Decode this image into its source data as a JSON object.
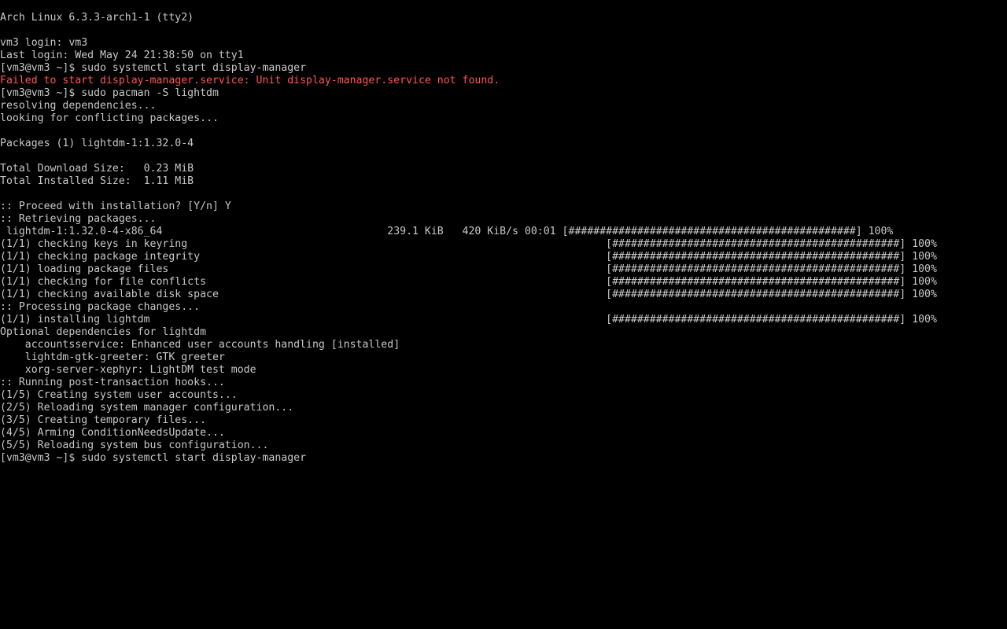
{
  "terminal": {
    "colors": {
      "background": "#000000",
      "foreground": "#c8c8c8",
      "error": "#ff5555"
    },
    "lines": [
      {
        "text": "Arch Linux 6.3.3-arch1-1 (tty2)",
        "type": "normal"
      },
      {
        "text": "",
        "type": "blank"
      },
      {
        "text": "vm3 login: vm3",
        "type": "normal"
      },
      {
        "text": "Last login: Wed May 24 21:38:50 on tty1",
        "type": "normal"
      },
      {
        "text": "[vm3@vm3 ~]$ sudo systemctl start display-manager",
        "type": "prompt"
      },
      {
        "text": "Failed to start display-manager.service: Unit display-manager.service not found.",
        "type": "error"
      },
      {
        "text": "[vm3@vm3 ~]$ sudo pacman -S lightdm",
        "type": "prompt"
      },
      {
        "text": "resolving dependencies...",
        "type": "normal"
      },
      {
        "text": "looking for conflicting packages...",
        "type": "normal"
      },
      {
        "text": "",
        "type": "blank"
      },
      {
        "text": "Packages (1) lightdm-1:1.32.0-4",
        "type": "normal"
      },
      {
        "text": "",
        "type": "blank"
      },
      {
        "text": "Total Download Size:   0.23 MiB",
        "type": "normal"
      },
      {
        "text": "Total Installed Size:  1.11 MiB",
        "type": "normal"
      },
      {
        "text": "",
        "type": "blank"
      },
      {
        "text": ":: Proceed with installation? [Y/n] Y",
        "type": "normal"
      },
      {
        "text": ":: Retrieving packages...",
        "type": "normal"
      },
      {
        "text": " lightdm-1:1.32.0-4-x86_64                                    239.1 KiB   420 KiB/s 00:01 [##############################################] 100%",
        "type": "progress"
      },
      {
        "text": "(1/1) checking keys in keyring                                                                   [##############################################] 100%",
        "type": "progress"
      },
      {
        "text": "(1/1) checking package integrity                                                                 [##############################################] 100%",
        "type": "progress"
      },
      {
        "text": "(1/1) loading package files                                                                      [##############################################] 100%",
        "type": "progress"
      },
      {
        "text": "(1/1) checking for file conflicts                                                                [##############################################] 100%",
        "type": "progress"
      },
      {
        "text": "(1/1) checking available disk space                                                              [##############################################] 100%",
        "type": "progress"
      },
      {
        "text": ":: Processing package changes...",
        "type": "normal"
      },
      {
        "text": "(1/1) installing lightdm                                                                         [##############################################] 100%",
        "type": "progress"
      },
      {
        "text": "Optional dependencies for lightdm",
        "type": "normal"
      },
      {
        "text": "    accountsservice: Enhanced user accounts handling [installed]",
        "type": "normal"
      },
      {
        "text": "    lightdm-gtk-greeter: GTK greeter",
        "type": "normal"
      },
      {
        "text": "    xorg-server-xephyr: LightDM test mode",
        "type": "normal"
      },
      {
        "text": ":: Running post-transaction hooks...",
        "type": "normal"
      },
      {
        "text": "(1/5) Creating system user accounts...",
        "type": "normal"
      },
      {
        "text": "(2/5) Reloading system manager configuration...",
        "type": "normal"
      },
      {
        "text": "(3/5) Creating temporary files...",
        "type": "normal"
      },
      {
        "text": "(4/5) Arming ConditionNeedsUpdate...",
        "type": "normal"
      },
      {
        "text": "(5/5) Reloading system bus configuration...",
        "type": "normal"
      },
      {
        "text": "[vm3@vm3 ~]$ sudo systemctl start display-manager",
        "type": "prompt"
      }
    ]
  }
}
